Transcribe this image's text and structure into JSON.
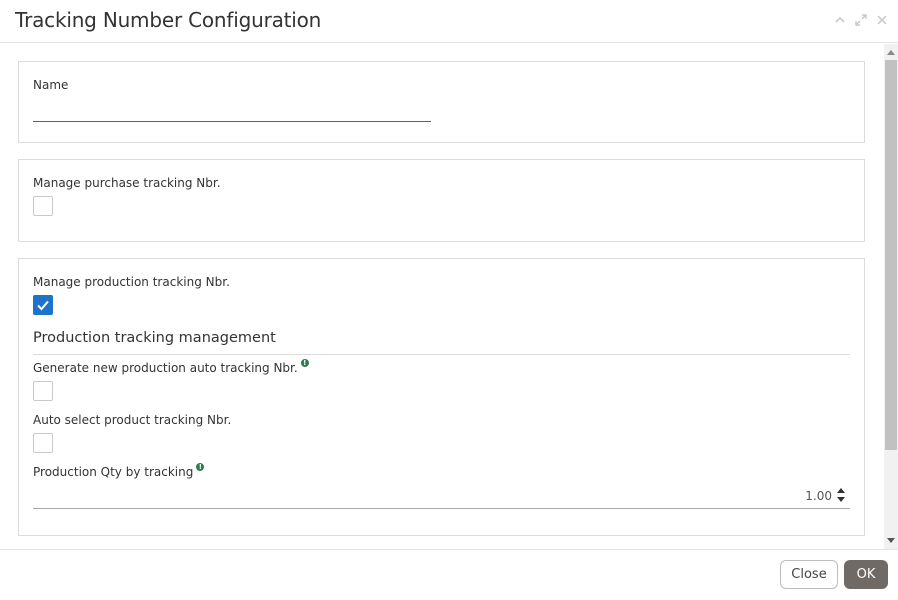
{
  "dialog": {
    "title": "Tracking Number Configuration"
  },
  "header_icons": [
    "collapse-icon",
    "maximize-icon",
    "close-icon"
  ],
  "name_panel": {
    "label": "Name",
    "value": ""
  },
  "purchase_panel": {
    "label": "Manage purchase tracking Nbr.",
    "checked": false
  },
  "production_panel": {
    "label": "Manage production tracking Nbr.",
    "checked": true,
    "section_title": "Production tracking management",
    "generate_label": "Generate new production auto tracking Nbr.",
    "generate_checked": false,
    "auto_select_label": "Auto select product tracking Nbr.",
    "auto_select_checked": false,
    "qty_label": "Production Qty by tracking",
    "qty_value": "1.00"
  },
  "footer": {
    "close_label": "Close",
    "ok_label": "OK"
  },
  "colors": {
    "accent_blue": "#1d73c9",
    "info_green": "#2e7d4f",
    "required_underline": "#a9413d",
    "ok_button": "#6f6a66"
  }
}
